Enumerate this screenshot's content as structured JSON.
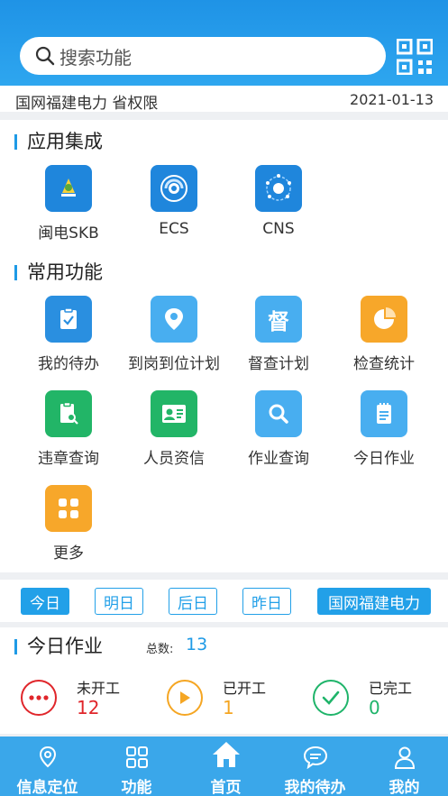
{
  "search": {
    "placeholder": "搜索功能"
  },
  "info": {
    "org": "国网福建电力 省权限",
    "date": "2021-01-13"
  },
  "sections": {
    "apps_title": "应用集成",
    "common_title": "常用功能"
  },
  "apps": [
    {
      "label": "闽电SKB",
      "icon": "lamp-icon",
      "color": "#1f86dc"
    },
    {
      "label": "ECS",
      "icon": "swirl-icon",
      "color": "#1f86dc"
    },
    {
      "label": "CNS",
      "icon": "network-icon",
      "color": "#1f86dc"
    }
  ],
  "functions": [
    {
      "label": "我的待办",
      "icon": "clipboard-check-icon",
      "color": "#2a8fe0"
    },
    {
      "label": "到岗到位计划",
      "icon": "location-pin-icon",
      "color": "#48aef0"
    },
    {
      "label": "督查计划",
      "icon": "supervise-icon",
      "color": "#48aef0",
      "glyph": "督"
    },
    {
      "label": "检查统计",
      "icon": "pie-chart-icon",
      "color": "#f7a72a"
    },
    {
      "label": "违章查询",
      "icon": "doc-search-icon",
      "color": "#22b567"
    },
    {
      "label": "人员资信",
      "icon": "id-card-icon",
      "color": "#22b567"
    },
    {
      "label": "作业查询",
      "icon": "magnifier-icon",
      "color": "#48aef0"
    },
    {
      "label": "今日作业",
      "icon": "notepad-icon",
      "color": "#48aef0"
    },
    {
      "label": "更多",
      "icon": "grid-more-icon",
      "color": "#f7a72a"
    }
  ],
  "date_tabs": [
    {
      "label": "今日",
      "active": true
    },
    {
      "label": "明日",
      "active": false
    },
    {
      "label": "后日",
      "active": false
    },
    {
      "label": "昨日",
      "active": false
    },
    {
      "label": "国网福建电力",
      "active": true
    }
  ],
  "today": {
    "title": "今日作业",
    "count_label": "总数:",
    "count": "13",
    "stats": [
      {
        "label": "未开工",
        "value": "12",
        "color": "#e0262b",
        "icon": "more-dots-icon"
      },
      {
        "label": "已开工",
        "value": "1",
        "color": "#f5a623",
        "icon": "play-icon"
      },
      {
        "label": "已完工",
        "value": "0",
        "color": "#1fb46a",
        "icon": "check-icon"
      }
    ]
  },
  "nav": [
    {
      "label": "信息定位",
      "icon": "location-icon"
    },
    {
      "label": "功能",
      "icon": "apps-icon"
    },
    {
      "label": "首页",
      "icon": "home-icon"
    },
    {
      "label": "我的待办",
      "icon": "chat-icon"
    },
    {
      "label": "我的",
      "icon": "user-icon"
    }
  ]
}
